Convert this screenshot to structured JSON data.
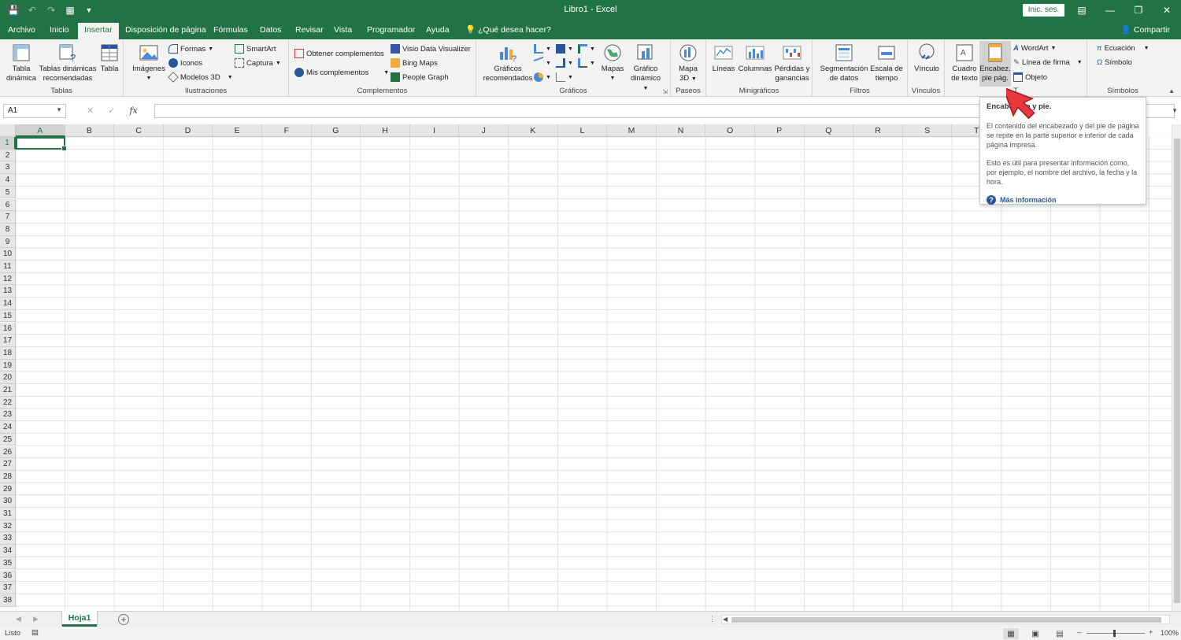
{
  "window": {
    "title": "Libro1  -  Excel",
    "signin_label": "Inic. ses.",
    "share_label": "Compartir"
  },
  "tabs": [
    "Archivo",
    "Inicio",
    "Insertar",
    "Disposición de página",
    "Fórmulas",
    "Datos",
    "Revisar",
    "Vista",
    "Programador",
    "Ayuda"
  ],
  "tell_me": "¿Qué desea hacer?",
  "ribbon": {
    "tablas": {
      "label": "Tablas",
      "pivot_line1": "Tabla",
      "pivot_line2": "dinámica",
      "rec_line1": "Tablas dinámicas",
      "rec_line2": "recomendadas",
      "table": "Tabla"
    },
    "ilustraciones": {
      "label": "Ilustraciones",
      "images": "Imágenes",
      "shapes": "Formas",
      "icons": "Iconos",
      "models3d": "Modelos 3D",
      "smartart": "SmartArt",
      "capture": "Captura"
    },
    "complementos": {
      "label": "Complementos",
      "get": "Obtener complementos",
      "mine": "Mis complementos",
      "visio": "Visio Data Visualizer",
      "bing": "Bing Maps",
      "people": "People Graph"
    },
    "graficos": {
      "label": "Gráficos",
      "rec_line1": "Gráficos",
      "rec_line2": "recomendados",
      "maps": "Mapas",
      "pivotchart_line1": "Gráfico",
      "pivotchart_line2": "dinámico"
    },
    "paseos": {
      "label": "Paseos",
      "map3d_line1": "Mapa",
      "map3d_line2": "3D"
    },
    "minigraficos": {
      "label": "Minigráficos",
      "lines": "Líneas",
      "columns": "Columnas",
      "winloss_line1": "Pérdidas y",
      "winloss_line2": "ganancias"
    },
    "filtros": {
      "label": "Filtros",
      "slicer_line1": "Segmentación",
      "slicer_line2": "de datos",
      "timeline_line1": "Escala de",
      "timeline_line2": "tiempo"
    },
    "vinculos": {
      "label": "Vínculos",
      "link": "Vínculo"
    },
    "texto": {
      "label": "T",
      "textbox_line1": "Cuadro",
      "textbox_line2": "de texto",
      "header_line1": "Encabez.",
      "header_line2": "pie pág.",
      "wordart": "WordArt",
      "signature": "Línea de firma",
      "object": "Objeto"
    },
    "simbolos": {
      "label": "Símbolos",
      "equation": "Ecuación",
      "symbol": "Símbolo"
    }
  },
  "formula_bar": {
    "name_box": "A1",
    "fx": "fx",
    "value": ""
  },
  "columns": [
    "A",
    "B",
    "C",
    "D",
    "E",
    "F",
    "G",
    "H",
    "I",
    "J",
    "K",
    "L",
    "M",
    "N",
    "O",
    "P",
    "Q",
    "R",
    "S",
    "T"
  ],
  "rows": [
    "1",
    "2",
    "3",
    "4",
    "5",
    "6",
    "7",
    "8",
    "9",
    "10",
    "11",
    "12",
    "13",
    "14",
    "15",
    "16",
    "17",
    "18",
    "19",
    "20",
    "21",
    "22",
    "23",
    "24",
    "25",
    "26",
    "27",
    "28",
    "29",
    "30",
    "31",
    "32",
    "33",
    "34",
    "35",
    "36",
    "37",
    "38"
  ],
  "sheet": {
    "name": "Hoja1"
  },
  "status": {
    "mode": "Listo",
    "zoom": "100%"
  },
  "tooltip": {
    "title": "Encabezado y pie.",
    "p1": "El contenido del encabezado y del pie de página se repite en la parte superior e inferior de cada página impresa.",
    "p2": "Esto es útil para presentar información como, por ejemplo, el nombre del archivo, la fecha y la hora.",
    "link": "Más información"
  },
  "colors": {
    "excel_green": "#217346",
    "ribbon_bg": "#f3f3f3",
    "pointer_red": "#e8383d"
  }
}
